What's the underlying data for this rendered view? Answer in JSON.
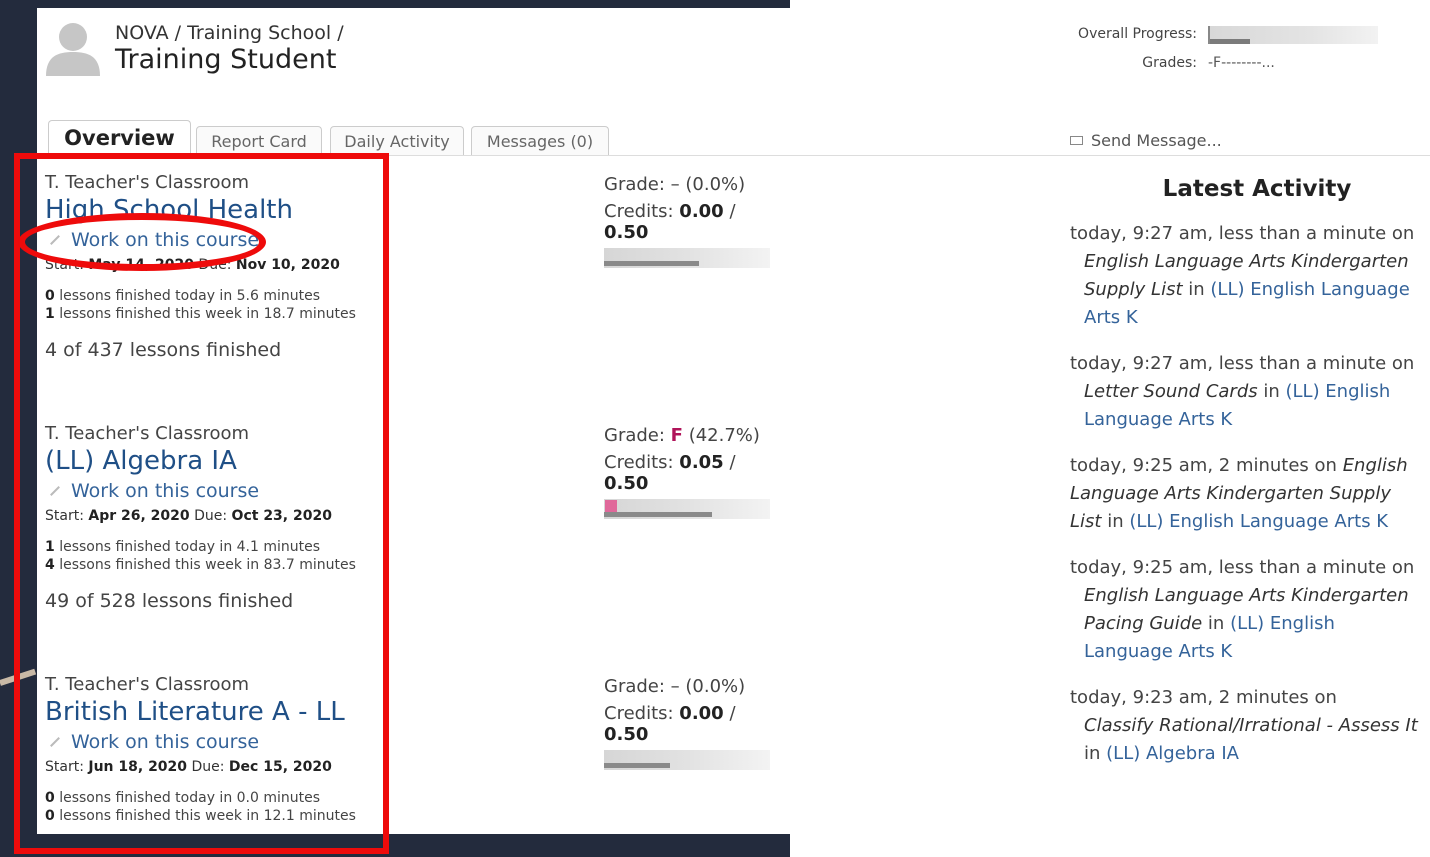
{
  "header": {
    "breadcrumb": "NOVA / Training School /",
    "student_name": "Training Student",
    "overall_progress_label": "Overall Progress:",
    "overall_progress_fraction": 0.24,
    "grades_label": "Grades:",
    "grades_value": "-F--------..."
  },
  "tabs": [
    {
      "label": "Overview",
      "active": true
    },
    {
      "label": "Report Card",
      "active": false
    },
    {
      "label": "Daily Activity",
      "active": false
    },
    {
      "label": "Messages (0)",
      "active": false
    }
  ],
  "send_message_label": "Send Message...",
  "courses": [
    {
      "classroom": "T. Teacher's Classroom",
      "title": "High School Health",
      "work_label": "Work on this course",
      "start_label": "Start:",
      "start": "May 14, 2020",
      "due_label": "Due:",
      "due": "Nov 10, 2020",
      "today_count": "0",
      "today_text": " lessons finished today in 5.6 minutes",
      "week_count": "1",
      "week_text": " lessons finished this week in 18.7 minutes",
      "finished": "4 of 437 lessons finished",
      "grade_prefix": "Grade: ",
      "grade_letter": "–",
      "grade_pct": " (0.0%)",
      "credits_label": "Credits: ",
      "credits_earned": "0.00",
      "credits_sep": " / ",
      "credits_total": "0.50",
      "credit_fraction": 0.57
    },
    {
      "classroom": "T. Teacher's Classroom",
      "title": "(LL) Algebra IA",
      "work_label": "Work on this course",
      "start_label": "Start:",
      "start": "Apr 26, 2020",
      "due_label": "Due:",
      "due": "Oct 23, 2020",
      "today_count": "1",
      "today_text": " lessons finished today in 4.1 minutes",
      "week_count": "4",
      "week_text": " lessons finished this week in 83.7 minutes",
      "finished": "49 of 528 lessons finished",
      "grade_prefix": "Grade: ",
      "grade_letter": "F",
      "grade_pct": " (42.7%)",
      "credits_label": "Credits: ",
      "credits_earned": "0.05",
      "credits_sep": " / ",
      "credits_total": "0.50",
      "credit_fraction": 0.65
    },
    {
      "classroom": "T. Teacher's Classroom",
      "title": "British Literature A - LL",
      "work_label": "Work on this course",
      "start_label": "Start:",
      "start": "Jun 18, 2020",
      "due_label": "Due:",
      "due": "Dec 15, 2020",
      "today_count": "0",
      "today_text": " lessons finished today in 0.0 minutes",
      "week_count": "0",
      "week_text": " lessons finished this week in 12.1 minutes",
      "finished": "",
      "grade_prefix": "Grade: ",
      "grade_letter": "–",
      "grade_pct": " (0.0%)",
      "credits_label": "Credits: ",
      "credits_earned": "0.00",
      "credits_sep": " / ",
      "credits_total": "0.50",
      "credit_fraction": 0.4
    }
  ],
  "activity": {
    "title": "Latest Activity",
    "items": [
      {
        "lead": "today, 9:27 am, less than a minute on",
        "lesson": "English Language Arts Kindergarten Supply List",
        "in": " in ",
        "course": "(LL) English Language Arts K"
      },
      {
        "lead": "today, 9:27 am, less than a minute on",
        "lesson": "Letter Sound Cards",
        "in": " in ",
        "course": "(LL) English Language Arts K"
      },
      {
        "lead": "today, 9:25 am, 2 minutes on",
        "lesson": "English Language Arts Kindergarten Supply List",
        "in": " in ",
        "course": "(LL) English Language Arts K"
      },
      {
        "lead": "today, 9:25 am, less than a minute on",
        "lesson": "English Language Arts Kindergarten Pacing Guide",
        "in": " in ",
        "course": "(LL) English Language Arts K"
      },
      {
        "lead": "today, 9:23 am, 2 minutes on",
        "lesson": "Classify Rational/Irrational - Assess It",
        "in": " in ",
        "course": "(LL) Algebra IA"
      }
    ]
  },
  "annotation_color": "#ee0b0b"
}
